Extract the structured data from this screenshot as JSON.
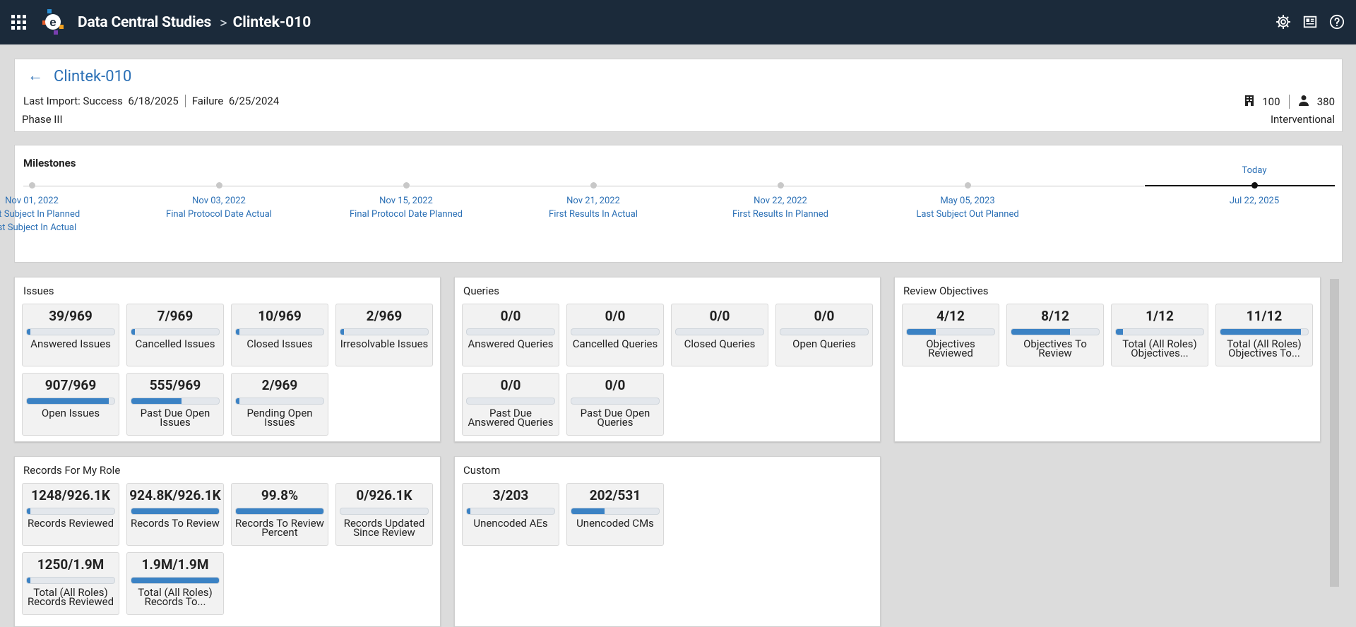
{
  "topbar": {
    "app_title": "Data Central Studies",
    "separator": ">",
    "study": "Clintek-010"
  },
  "header": {
    "title": "Clintek-010",
    "last_import_label": "Last Import:",
    "success_label": "Success",
    "success_date": "6/18/2025",
    "failure_label": "Failure",
    "failure_date": "6/25/2024",
    "phase": "Phase III",
    "sites_count": "100",
    "subjects_count": "380",
    "study_type": "Interventional"
  },
  "milestones": {
    "title": "Milestones",
    "today_label": "Today",
    "today_date": "Jul 22, 2025",
    "items": [
      {
        "date": "Nov 01, 2022",
        "names": "First Subject In Planned\nFirst Subject In Actual"
      },
      {
        "date": "Nov 03, 2022",
        "names": "Final Protocol Date Actual"
      },
      {
        "date": "Nov 15, 2022",
        "names": "Final Protocol Date Planned"
      },
      {
        "date": "Nov 21, 2022",
        "names": "First Results In Actual"
      },
      {
        "date": "Nov 22, 2022",
        "names": "First Results In Planned"
      },
      {
        "date": "May 05, 2023",
        "names": "Last Subject Out Planned"
      }
    ]
  },
  "panels": {
    "issues": {
      "title": "Issues",
      "tiles": [
        {
          "value": "39/969",
          "label": "Answered Issues",
          "progress": 0.04
        },
        {
          "value": "7/969",
          "label": "Cancelled Issues",
          "progress": 0.007
        },
        {
          "value": "10/969",
          "label": "Closed Issues",
          "progress": 0.01
        },
        {
          "value": "2/969",
          "label": "Irresolvable Issues",
          "progress": 0.002
        },
        {
          "value": "907/969",
          "label": "Open Issues",
          "progress": 0.936
        },
        {
          "value": "555/969",
          "label": "Past Due Open Issues",
          "progress": 0.573
        },
        {
          "value": "2/969",
          "label": "Pending Open Issues",
          "progress": 0.002
        }
      ]
    },
    "queries": {
      "title": "Queries",
      "tiles": [
        {
          "value": "0/0",
          "label": "Answered Queries",
          "progress": 0
        },
        {
          "value": "0/0",
          "label": "Cancelled Queries",
          "progress": 0
        },
        {
          "value": "0/0",
          "label": "Closed Queries",
          "progress": 0
        },
        {
          "value": "0/0",
          "label": "Open Queries",
          "progress": 0
        },
        {
          "value": "0/0",
          "label": "Past Due Answered Queries",
          "progress": 0
        },
        {
          "value": "0/0",
          "label": "Past Due Open Queries",
          "progress": 0
        }
      ]
    },
    "review": {
      "title": "Review Objectives",
      "tiles": [
        {
          "value": "4/12",
          "label": "Objectives Reviewed",
          "progress": 0.333
        },
        {
          "value": "8/12",
          "label": "Objectives To Review",
          "progress": 0.667
        },
        {
          "value": "1/12",
          "label": "Total (All Roles) Objectives...",
          "progress": 0.083
        },
        {
          "value": "11/12",
          "label": "Total (All Roles) Objectives To...",
          "progress": 0.917
        }
      ]
    },
    "records": {
      "title": "Records For My Role",
      "tiles": [
        {
          "value": "1248/926.1K",
          "label": "Records Reviewed",
          "progress": 0.0013
        },
        {
          "value": "924.8K/926.1K",
          "label": "Records To Review",
          "progress": 0.998
        },
        {
          "value": "99.8%",
          "label": "Records To Review Percent",
          "progress": 0.998
        },
        {
          "value": "0/926.1K",
          "label": "Records Updated Since Review",
          "progress": 0
        },
        {
          "value": "1250/1.9M",
          "label": "Total (All Roles) Records Reviewed",
          "progress": 0.0007
        },
        {
          "value": "1.9M/1.9M",
          "label": "Total (All Roles) Records To...",
          "progress": 1
        }
      ]
    },
    "custom": {
      "title": "Custom",
      "tiles": [
        {
          "value": "3/203",
          "label": "Unencoded AEs",
          "progress": 0.015
        },
        {
          "value": "202/531",
          "label": "Unencoded CMs",
          "progress": 0.38
        }
      ]
    }
  }
}
